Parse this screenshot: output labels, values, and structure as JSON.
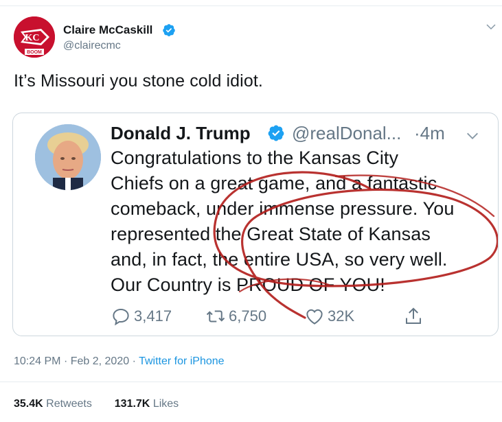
{
  "tweet": {
    "author_name": "Claire McCaskill",
    "author_handle": "@clairecmc",
    "avatar_badge_text": "BOOM",
    "text": "It’s Missouri you stone cold idiot.",
    "time": "10:24 PM",
    "date": "Feb 2, 2020",
    "source": "Twitter for iPhone",
    "retweets_count": "35.4K",
    "retweets_label": "Retweets",
    "likes_count": "131.7K",
    "likes_label": "Likes"
  },
  "quoted": {
    "author_name": "Donald J. Trump",
    "author_handle": "@realDonal...",
    "time": "·4m",
    "lines": [
      "Congratulations to the Kansas City",
      "Chiefs on a great game, and a fantastic",
      "comeback, under immense pressure. You",
      "represented the Great State of Kansas",
      "and, in fact, the entire USA, so very well.",
      "Our Country is PROUD OF YOU!"
    ],
    "replies": "3,417",
    "retweets": "6,750",
    "likes": "32K"
  },
  "colors": {
    "accent": "#1b95e0",
    "verified": "#1da1f2",
    "muted": "#657786",
    "annotation": "#b3211e",
    "chiefs_red": "#c8102e"
  },
  "icons": [
    "chiefs-logo",
    "verified-icon",
    "chevron-down-icon",
    "reply-icon",
    "retweet-icon",
    "like-icon",
    "share-icon"
  ]
}
